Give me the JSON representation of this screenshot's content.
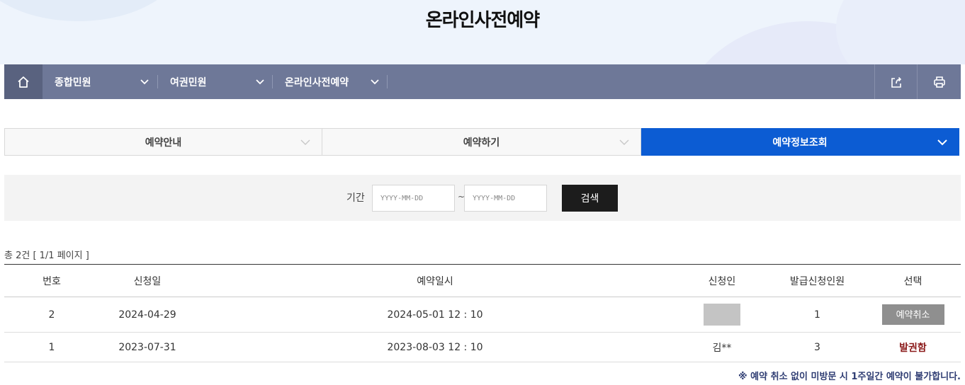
{
  "page": {
    "title": "온라인사전예약"
  },
  "nav": {
    "menus": [
      {
        "label": "종합민원"
      },
      {
        "label": "여권민원"
      },
      {
        "label": "온라인사전예약"
      }
    ]
  },
  "tabs": [
    {
      "label": "예약안내",
      "active": false
    },
    {
      "label": "예약하기",
      "active": false
    },
    {
      "label": "예약정보조회",
      "active": true
    }
  ],
  "search": {
    "period_label": "기간",
    "start_placeholder": "YYYY-MM-DD",
    "end_placeholder": "YYYY-MM-DD",
    "separator": "~",
    "button_label": "검색"
  },
  "results": {
    "count_text": "총 2건 [ 1/1 페이지 ]",
    "columns": [
      "번호",
      "신청일",
      "예약일시",
      "신청인",
      "발급신청인원",
      "선택"
    ],
    "rows": [
      {
        "no": "2",
        "applied": "2024-04-29",
        "reserved": "2024-05-01 12 : 10",
        "applicant": "",
        "count": "1",
        "action": "예약취소"
      },
      {
        "no": "1",
        "applied": "2023-07-31",
        "reserved": "2023-08-03 12 : 10",
        "applicant": "김**",
        "count": "3",
        "status": "발권함"
      }
    ]
  },
  "notice": "※ 예약 취소 없이 미방문 시 1주일간 예약이 불가합니다.",
  "colors": {
    "nav_bg": "#6e7898",
    "tab_active": "#0c5cd3",
    "search_button": "#1c1c1c",
    "status_issued": "#8b1a1a",
    "notice": "#2f3d73"
  }
}
